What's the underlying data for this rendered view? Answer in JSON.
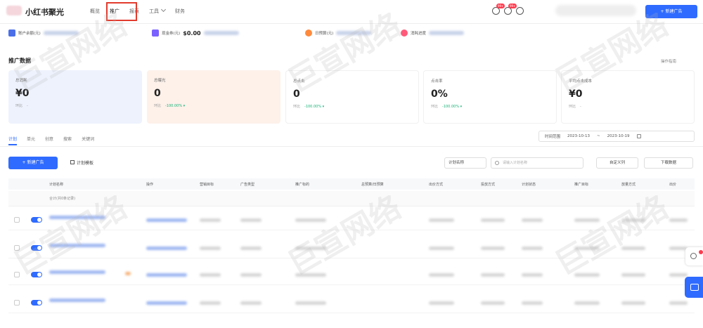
{
  "header": {
    "app_title": "小红书聚光",
    "nav": [
      "概览",
      "推广",
      "报表",
      "工具",
      "财务"
    ],
    "active_nav": "推广",
    "badges": [
      "99+",
      "99+"
    ],
    "create_button": "+ 新建广告"
  },
  "account": {
    "items": [
      {
        "label": "账户余额(元)",
        "value": "",
        "color": "#4a6fe8"
      },
      {
        "label": "现金券(元)",
        "value": "$0.00",
        "color": "#7b61ff"
      },
      {
        "label": "日预算(元)",
        "value": "",
        "color": "#ff8a3d"
      },
      {
        "label": "消耗进度",
        "value": "",
        "color": "#ff5a7a"
      }
    ]
  },
  "section": {
    "title": "推广数据",
    "right": "操作指南"
  },
  "kpis": [
    {
      "label": "总消耗",
      "value": "¥0",
      "foot": "环比",
      "pct": "-",
      "bg": "#eef2fd"
    },
    {
      "label": "总曝光",
      "value": "0",
      "foot": "环比",
      "pct": "-100.00% ▾",
      "bg": "#fdf1ea"
    },
    {
      "label": "总点击",
      "value": "0",
      "foot": "环比",
      "pct": "-100.00% ▾",
      "bg": "#ffffff"
    },
    {
      "label": "点击率",
      "value": "0%",
      "foot": "环比",
      "pct": "-100.00% ▾",
      "bg": "#ffffff"
    },
    {
      "label": "平均点击成本",
      "value": "¥0",
      "foot": "环比",
      "pct": "-",
      "bg": "#ffffff"
    }
  ],
  "tabs": [
    "计划",
    "单元",
    "创意",
    "搜索",
    "关键词"
  ],
  "date": {
    "label": "时间范围",
    "start": "2023-10-13",
    "sep": "~",
    "end": "2023-10-19"
  },
  "toolbar": {
    "new_label": "+ 新建广告",
    "template_label": "计划模板",
    "filter_label": "计划名称",
    "search_placeholder": "请输入计划名称",
    "columns_label": "自定义列",
    "download_label": "下载数据"
  },
  "table": {
    "headers": [
      "计划名称",
      "操作",
      "营销目标",
      "广告类型",
      "推广标的",
      "总预算/日预算",
      "出价方式",
      "投放方式",
      "计划状态",
      "推广目标",
      "放量方式",
      "出价"
    ],
    "summary_label": "合计(共0条记录)",
    "row_count": 5
  },
  "watermark": "巨宣网络"
}
